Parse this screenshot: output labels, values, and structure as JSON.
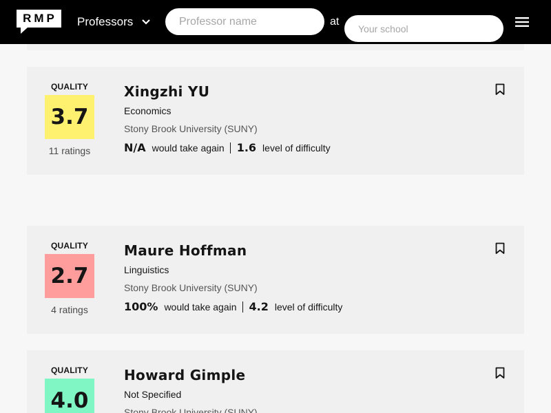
{
  "header": {
    "logo_text": "RMP",
    "dropdown_label": "Professors",
    "name_placeholder": "Professor name",
    "at_label": "at",
    "school_placeholder": "Your school"
  },
  "quality_label": "QUALITY",
  "would_take_again_label": "would take again",
  "difficulty_label": "level of difficulty",
  "colors": {
    "quality_high": "#7ff6c3",
    "quality_mid": "#fff170",
    "quality_low": "#ff9c9c"
  },
  "professors": [
    {
      "rating": "3.7",
      "ratings_count": "11 ratings",
      "name": "Xingzhi YU",
      "department": "Economics",
      "school": "Stony Brook University (SUNY)",
      "would_take_again": "N/A",
      "difficulty": "1.6"
    },
    {
      "rating": "2.7",
      "ratings_count": "4 ratings",
      "name": "Maure Hoffman",
      "department": "Linguistics",
      "school": "Stony Brook University (SUNY)",
      "would_take_again": "100%",
      "difficulty": "4.2"
    },
    {
      "rating": "4.0",
      "name": "Howard Gimple",
      "department": "Not Specified",
      "school": "Stony Brook University (SUNY)"
    }
  ]
}
